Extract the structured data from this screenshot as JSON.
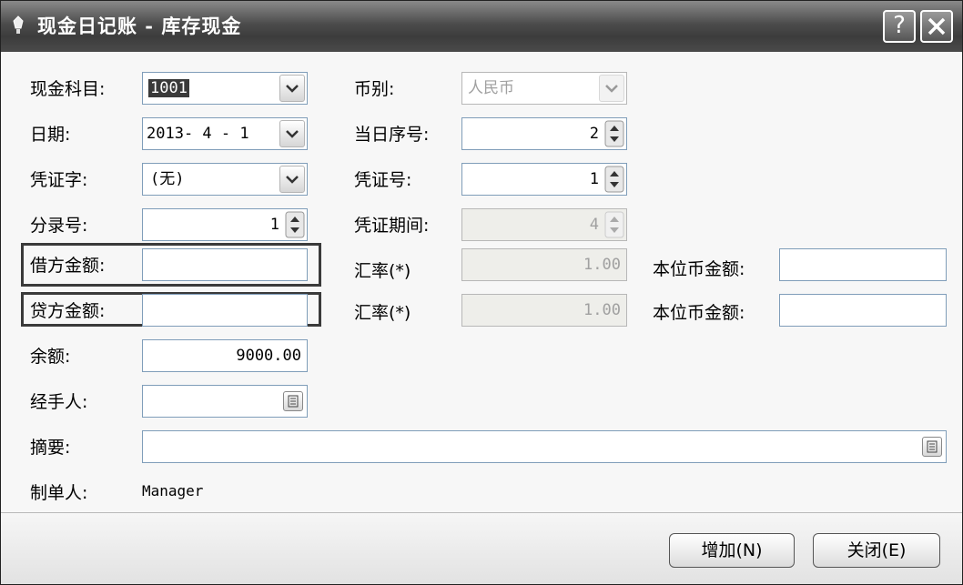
{
  "window": {
    "title": "现金日记账 - 库存现金"
  },
  "fields": {
    "cash_account": {
      "label": "现金科目:",
      "value": "1001"
    },
    "date": {
      "label": "日期:",
      "value": "2013- 4 - 1"
    },
    "voucher_word": {
      "label": "凭证字:",
      "value": "(无)"
    },
    "entry_no": {
      "label": "分录号:",
      "value": "1"
    },
    "debit_amount": {
      "label": "借方金额:",
      "value": ""
    },
    "credit_amount": {
      "label": "贷方金额:",
      "value": ""
    },
    "balance": {
      "label": "余额:",
      "value": "9000.00"
    },
    "handler": {
      "label": "经手人:",
      "value": ""
    },
    "summary": {
      "label": "摘要:",
      "value": ""
    },
    "preparer": {
      "label": "制单人:",
      "value": "Manager"
    },
    "currency": {
      "label": "币别:",
      "value": "人民币"
    },
    "daily_seq": {
      "label": "当日序号:",
      "value": "2"
    },
    "voucher_no": {
      "label": "凭证号:",
      "value": "1"
    },
    "voucher_period": {
      "label": "凭证期间:",
      "value": "4"
    },
    "rate1": {
      "label": "汇率(*)",
      "value": "1.00"
    },
    "rate2": {
      "label": "汇率(*)",
      "value": "1.00"
    },
    "local_amount1": {
      "label": "本位币金额:",
      "value": ""
    },
    "local_amount2": {
      "label": "本位币金额:",
      "value": ""
    }
  },
  "buttons": {
    "add": "增加(N)",
    "close": "关闭(E)"
  },
  "icons": {
    "title": "pen-icon",
    "help": "help-icon",
    "close": "close-icon",
    "dropdown": "chevron-down-icon",
    "spin": "spinner-icon",
    "picker": "list-picker-icon"
  },
  "colors": {
    "titlebar": "#4c4c4c",
    "highlight_border": "#3a3a3a",
    "disabled_bg": "#eeeeea"
  }
}
